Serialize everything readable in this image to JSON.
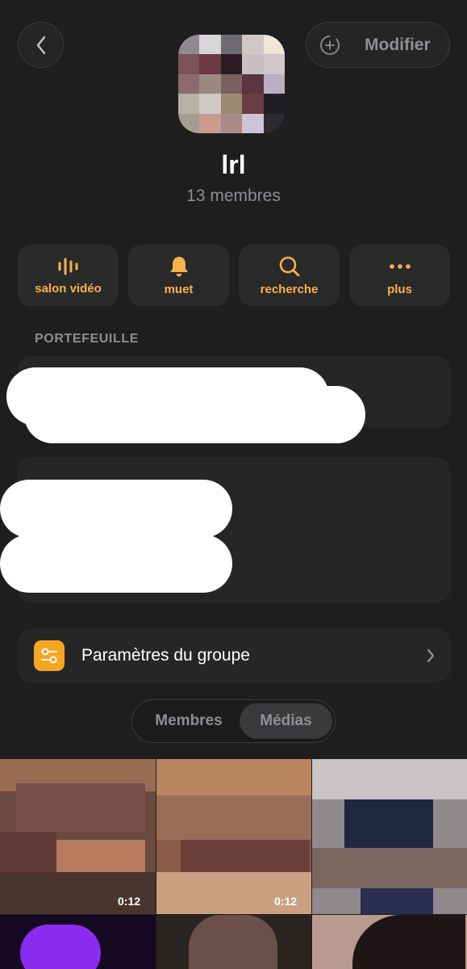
{
  "header": {
    "edit_label": "Modifier"
  },
  "group": {
    "name": "lrl",
    "members": "13 membres"
  },
  "actions": [
    {
      "label": "salon vidéo",
      "icon": "waveform-icon"
    },
    {
      "label": "muet",
      "icon": "bell-icon"
    },
    {
      "label": "recherche",
      "icon": "search-icon"
    },
    {
      "label": "plus",
      "icon": "more-icon"
    }
  ],
  "wallet": {
    "section_title": "PORTEFEUILLE"
  },
  "settings": {
    "label": "Paramètres du groupe"
  },
  "tabs": {
    "members": "Membres",
    "media": "Médias"
  },
  "media": [
    {
      "duration": "0:12"
    },
    {
      "duration": "0:12"
    }
  ],
  "colors": {
    "accent": "#f7b24a",
    "background": "#1e1e1f",
    "card": "#262627"
  }
}
